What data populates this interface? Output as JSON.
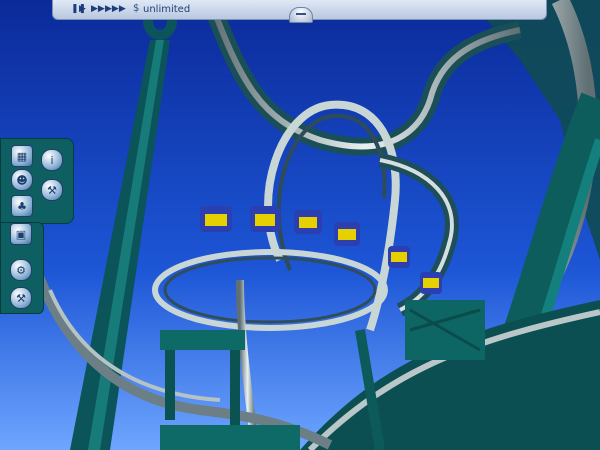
{
  "hud": {
    "money_label": "unlimited",
    "money_icon": "coin-icon",
    "speed_controls": [
      "pause-icon",
      "play-icon",
      "fast-forward-icon",
      "fastest-forward-icon"
    ],
    "center_button": "camera-knob-icon"
  },
  "tool_panel": {
    "buttons": [
      {
        "icon": "map-icon"
      },
      {
        "icon": "info-icon"
      },
      {
        "icon": "guests-icon"
      },
      {
        "icon": "staff-icon"
      },
      {
        "icon": "scenery-icon"
      },
      {
        "icon": "finance-icon"
      },
      {
        "icon": "ride-icon"
      },
      {
        "icon": "tools-icon"
      }
    ]
  },
  "colors": {
    "sky_top": "#0b2a9a",
    "sky_bottom": "#6ea6ff",
    "track_teal": "#0b6c6a",
    "rail_steel": "#c9d6d6",
    "train_blue": "#2b3fb0",
    "train_yellow": "#e6d000"
  }
}
